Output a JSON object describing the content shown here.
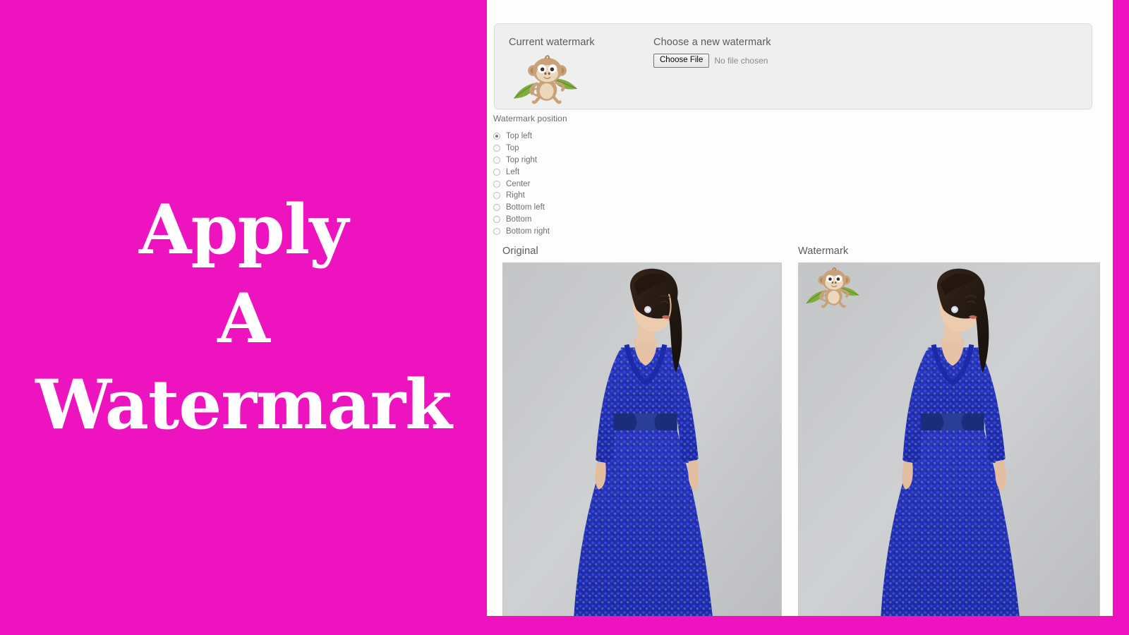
{
  "theme": {
    "accent_pink": "#ED13BE",
    "panel_bg": "#fdfdfd",
    "card_bg": "#efefef",
    "text_grey": "#5b5b5b"
  },
  "hero": {
    "line1": "Apply",
    "line2": "A",
    "line3": "Watermark"
  },
  "upload_card": {
    "current_label": "Current watermark",
    "current_watermark_icon": "monkey-watermark-image",
    "choose_label": "Choose a new watermark",
    "file_button_label": "Choose File",
    "file_status": "No file chosen"
  },
  "position": {
    "title": "Watermark position",
    "selected": "Top left",
    "options": [
      {
        "label": "Top left",
        "checked": true
      },
      {
        "label": "Top",
        "checked": false
      },
      {
        "label": "Top right",
        "checked": false
      },
      {
        "label": "Left",
        "checked": false
      },
      {
        "label": "Center",
        "checked": false
      },
      {
        "label": "Right",
        "checked": false
      },
      {
        "label": "Bottom left",
        "checked": false
      },
      {
        "label": "Bottom",
        "checked": false
      },
      {
        "label": "Bottom right",
        "checked": false
      }
    ]
  },
  "previews": {
    "original": {
      "title": "Original",
      "image_alt": "woman-in-blue-textured-gown-grey-background"
    },
    "watermarked": {
      "title": "Watermark",
      "image_alt": "woman-in-blue-textured-gown-grey-background-with-monkey-watermark-top-left",
      "overlay_icon": "monkey-watermark-image"
    }
  }
}
